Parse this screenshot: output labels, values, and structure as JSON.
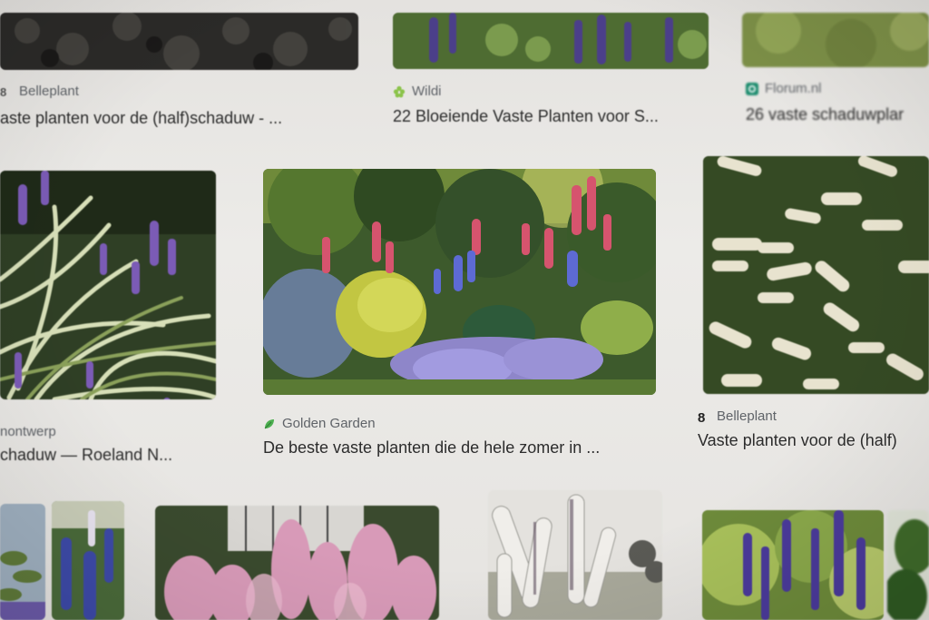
{
  "results": [
    {
      "source": "Belleplant",
      "title": "aste planten voor de (half)schaduw - ...",
      "favicon": "belleplant-icon"
    },
    {
      "source": "Wildi",
      "title": "22 Bloeiende Vaste Planten voor S...",
      "favicon": "wildi-flower-icon"
    },
    {
      "source": "Florum.nl",
      "title": "26 vaste schaduwplar",
      "favicon": "florum-icon"
    },
    {
      "source": "nontwerp",
      "title": "chaduw — Roeland N...",
      "favicon": ""
    },
    {
      "source": "Golden Garden",
      "title": "De beste vaste planten die de hele zomer in ...",
      "favicon": "golden-garden-leaf-icon"
    },
    {
      "source": "Belleplant",
      "title": "Vaste planten voor de (half)",
      "favicon": "belleplant-icon"
    }
  ],
  "colors": {
    "background": "#e9e7e4",
    "source_text": "#5f6368",
    "title_text": "#2c2c2c",
    "wildi_green": "#8bc34a",
    "florum_teal": "#1e8c6e",
    "golden_green": "#4caf50"
  }
}
